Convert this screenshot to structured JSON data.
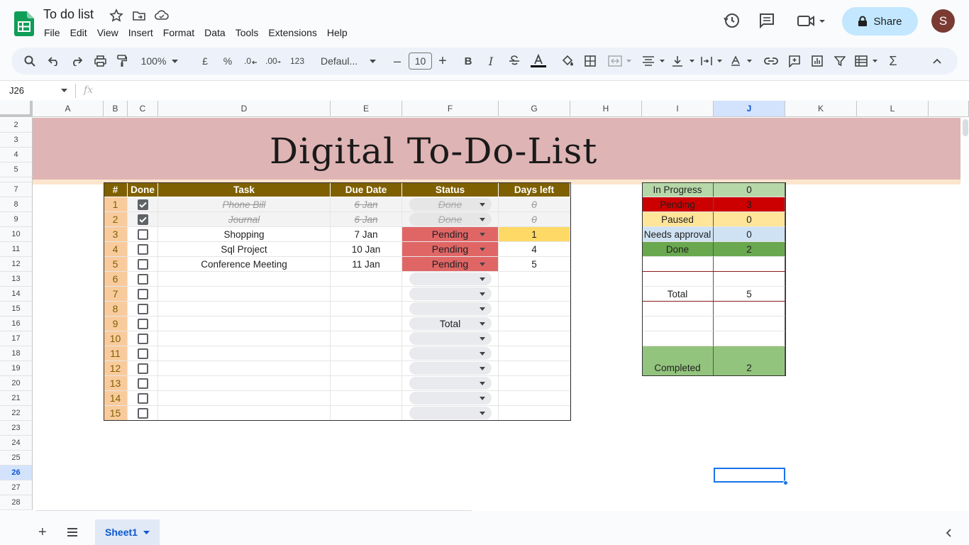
{
  "app": {
    "doc_title": "To do list",
    "menu": [
      "File",
      "Edit",
      "View",
      "Insert",
      "Format",
      "Data",
      "Tools",
      "Extensions",
      "Help"
    ],
    "share_label": "Share",
    "avatar_letter": "S"
  },
  "toolbar": {
    "zoom": "100%",
    "currency": "£",
    "percent": "%",
    "dec_less": ".0",
    "dec_more": ".00",
    "format_123": "123",
    "font": "Defaul...",
    "font_size": "10",
    "minus": "–",
    "plus": "+"
  },
  "formula_bar": {
    "name_box": "J26",
    "fx": "fx",
    "value": ""
  },
  "columns": [
    "A",
    "B",
    "C",
    "D",
    "E",
    "F",
    "G",
    "H",
    "I",
    "J",
    "K",
    "L"
  ],
  "rows": [
    "2",
    "3",
    "4",
    "5",
    "6",
    "7",
    "8",
    "9",
    "10",
    "11",
    "12",
    "13",
    "14",
    "15",
    "16",
    "17",
    "18",
    "19",
    "20",
    "21",
    "22",
    "23",
    "24",
    "25",
    "26",
    "27",
    "28"
  ],
  "selected_cell": "J26",
  "banner": {
    "title": "Digital To-Do-List",
    "color": "#dfb4b4"
  },
  "todo": {
    "headers": [
      "#",
      "Done",
      "Task",
      "Due Date",
      "Status",
      "Days left"
    ],
    "rows": [
      {
        "n": "1",
        "done": true,
        "task": "Phone Bill",
        "due": "6 Jan",
        "status": "Done",
        "days": "0"
      },
      {
        "n": "2",
        "done": true,
        "task": "Journal",
        "due": "6 Jan",
        "status": "Done",
        "days": "0"
      },
      {
        "n": "3",
        "done": false,
        "task": "Shopping",
        "due": "7 Jan",
        "status": "Pending",
        "days": "1"
      },
      {
        "n": "4",
        "done": false,
        "task": "Sql Project",
        "due": "10 Jan",
        "status": "Pending",
        "days": "4"
      },
      {
        "n": "5",
        "done": false,
        "task": "Conference Meeting",
        "due": "11 Jan",
        "status": "Pending",
        "days": "5"
      },
      {
        "n": "6",
        "done": false,
        "task": "",
        "due": "",
        "status": "",
        "days": ""
      },
      {
        "n": "7",
        "done": false,
        "task": "",
        "due": "",
        "status": "",
        "days": ""
      },
      {
        "n": "8",
        "done": false,
        "task": "",
        "due": "",
        "status": "",
        "days": ""
      },
      {
        "n": "9",
        "done": false,
        "task": "",
        "due": "",
        "status": "Total",
        "days": ""
      },
      {
        "n": "10",
        "done": false,
        "task": "",
        "due": "",
        "status": "",
        "days": ""
      },
      {
        "n": "11",
        "done": false,
        "task": "",
        "due": "",
        "status": "",
        "days": ""
      },
      {
        "n": "12",
        "done": false,
        "task": "",
        "due": "",
        "status": "",
        "days": ""
      },
      {
        "n": "13",
        "done": false,
        "task": "",
        "due": "",
        "status": "",
        "days": ""
      },
      {
        "n": "14",
        "done": false,
        "task": "",
        "due": "",
        "status": "",
        "days": ""
      },
      {
        "n": "15",
        "done": false,
        "task": "",
        "due": "",
        "status": "",
        "days": ""
      }
    ]
  },
  "summary": {
    "items": [
      {
        "label": "In Progress",
        "value": "0",
        "color": "#b6d7a8"
      },
      {
        "label": "Pending",
        "value": "3",
        "color": "#cc0000"
      },
      {
        "label": "Paused",
        "value": "0",
        "color": "#ffe599"
      },
      {
        "label": "Needs approval",
        "value": "0",
        "color": "#cfe2f3"
      },
      {
        "label": "Done",
        "value": "2",
        "color": "#6aa84f"
      }
    ],
    "total_label": "Total",
    "total_value": "5",
    "completed_label": "Completed",
    "completed_value": "2",
    "completed_color": "#93c47d"
  },
  "sheets": {
    "active": "Sheet1"
  },
  "colors": {
    "header_brown": "#7f6000",
    "num_orange": "#f9cb9c",
    "pending_red": "#e06666",
    "days_yellow": "#ffd966",
    "share_blue": "#c2e7ff"
  }
}
